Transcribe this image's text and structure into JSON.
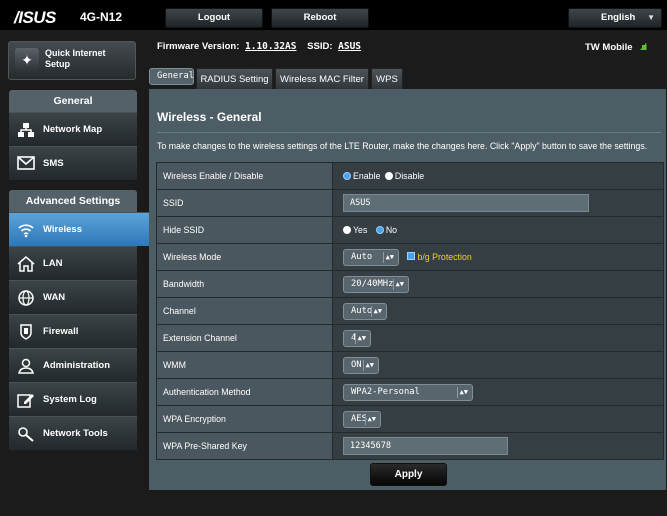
{
  "header": {
    "logo": "/ISUS",
    "model": "4G-N12",
    "logout_label": "Logout",
    "reboot_label": "Reboot",
    "language": "English",
    "firmware_label": "Firmware Version:",
    "firmware_value": "1.10.32AS",
    "ssid_label": "SSID:",
    "ssid_value": "ASUS",
    "carrier": "TW Mobile",
    "signal": ".ııl"
  },
  "sidebar": {
    "quick_setup": "Quick Internet Setup",
    "general_heading": "General",
    "general_items": [
      {
        "label": "Network Map",
        "icon": "network-map-icon"
      },
      {
        "label": "SMS",
        "icon": "envelope-icon"
      }
    ],
    "advanced_heading": "Advanced Settings",
    "advanced_items": [
      {
        "label": "Wireless",
        "icon": "wifi-icon",
        "active": true
      },
      {
        "label": "LAN",
        "icon": "home-icon"
      },
      {
        "label": "WAN",
        "icon": "globe-icon"
      },
      {
        "label": "Firewall",
        "icon": "shield-icon"
      },
      {
        "label": "Administration",
        "icon": "person-icon"
      },
      {
        "label": "System Log",
        "icon": "edit-icon"
      },
      {
        "label": "Network Tools",
        "icon": "tools-icon"
      }
    ]
  },
  "tabs": [
    "General",
    "RADIUS Setting",
    "Wireless MAC Filter",
    "WPS"
  ],
  "main": {
    "title": "Wireless - General",
    "description": "To make changes to the wireless settings of the LTE Router, make the changes here. Click \"Apply\" button to save the settings.",
    "rows": {
      "enable_label": "Wireless Enable / Disable",
      "enable_opt": "Enable",
      "disable_opt": "Disable",
      "ssid_label": "SSID",
      "ssid_value": "ASUS",
      "hide_label": "Hide SSID",
      "yes_opt": "Yes",
      "no_opt": "No",
      "mode_label": "Wireless Mode",
      "mode_value": "Auto",
      "bg_label": "b/g Protection",
      "bw_label": "Bandwidth",
      "bw_value": "20/40MHz",
      "ch_label": "Channel",
      "ch_value": "Auto",
      "ext_label": "Extension Channel",
      "ext_value": "4",
      "wmm_label": "WMM",
      "wmm_value": "ON",
      "auth_label": "Authentication Method",
      "auth_value": "WPA2-Personal",
      "enc_label": "WPA Encryption",
      "enc_value": "AES",
      "psk_label": "WPA Pre-Shared Key",
      "psk_value": "12345678"
    },
    "apply_label": "Apply"
  },
  "colors": {
    "accent": "#2f7bc0",
    "panel": "#4d5d65",
    "warning_text": "#f4d21c",
    "signal": "#6cdf31"
  }
}
